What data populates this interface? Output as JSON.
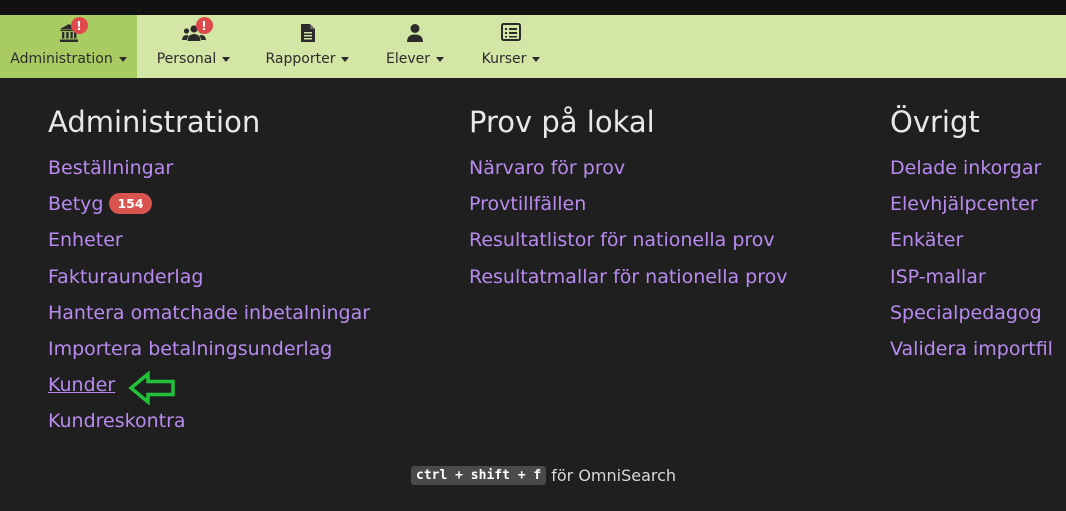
{
  "nav": {
    "items": [
      {
        "label": "Administration",
        "icon": "bank-icon",
        "alert": "!"
      },
      {
        "label": "Personal",
        "icon": "users-icon",
        "alert": "!"
      },
      {
        "label": "Rapporter",
        "icon": "document-icon"
      },
      {
        "label": "Elever",
        "icon": "user-icon"
      },
      {
        "label": "Kurser",
        "icon": "list-icon"
      }
    ]
  },
  "columns": [
    {
      "title": "Administration",
      "items": [
        {
          "label": "Beställningar"
        },
        {
          "label": "Betyg",
          "badge": "154"
        },
        {
          "label": "Enheter"
        },
        {
          "label": "Fakturaunderlag"
        },
        {
          "label": "Hantera omatchade inbetalningar"
        },
        {
          "label": "Importera betalningsunderlag"
        },
        {
          "label": "Kunder"
        },
        {
          "label": "Kundreskontra"
        }
      ]
    },
    {
      "title": "Prov på lokal",
      "items": [
        {
          "label": "Närvaro för prov"
        },
        {
          "label": "Provtillfällen"
        },
        {
          "label": "Resultatlistor för nationella prov"
        },
        {
          "label": "Resultatmallar för nationella prov"
        }
      ]
    },
    {
      "title": "Övrigt",
      "items": [
        {
          "label": "Delade inkorgar"
        },
        {
          "label": "Elevhjälpcenter"
        },
        {
          "label": "Enkäter"
        },
        {
          "label": "ISP-mallar"
        },
        {
          "label": "Specialpedagog"
        },
        {
          "label": "Validera importfil"
        }
      ]
    }
  ],
  "omnisearch": {
    "shortcut": "ctrl + shift + f",
    "text": "för OmniSearch"
  },
  "colors": {
    "nav_bg": "#d4e6a6",
    "nav_active": "#a9cc62",
    "link": "#b98bf0",
    "badge": "#d9534f",
    "arrow": "#22c13a"
  }
}
